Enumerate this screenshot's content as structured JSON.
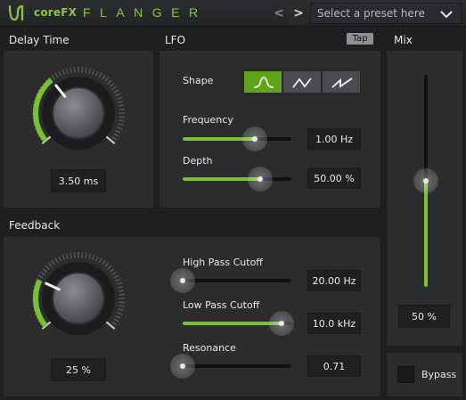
{
  "header": {
    "app_name": "coreFX",
    "plugin_name": "FLANGER",
    "prev_label": "<",
    "next_label": ">",
    "preset_placeholder": "Select a preset here"
  },
  "delay": {
    "label": "Delay Time",
    "value": "3.50 ms",
    "knob_fraction": 0.35
  },
  "lfo": {
    "label": "LFO",
    "tap_label": "Tap",
    "shape_label": "Shape",
    "shapes": [
      "sine",
      "triangle",
      "sawtooth"
    ],
    "selected_shape": "sine",
    "frequency_label": "Frequency",
    "frequency_value": "1.00 Hz",
    "frequency_fraction": 0.66,
    "depth_label": "Depth",
    "depth_value": "50.00 %",
    "depth_fraction": 0.71
  },
  "mix": {
    "label": "Mix",
    "value": "50 %",
    "fraction": 0.5
  },
  "feedback": {
    "label": "Feedback",
    "value": "25 %",
    "knob_fraction": 0.25,
    "hp_label": "High Pass Cutoff",
    "hp_value": "20.00 Hz",
    "hp_fraction": 0.0,
    "lp_label": "Low Pass Cutoff",
    "lp_value": "10.0 kHz",
    "lp_fraction": 0.91,
    "res_label": "Resonance",
    "res_value": "0.71",
    "res_fraction": 0.0
  },
  "bypass": {
    "label": "Bypass",
    "checked": false
  },
  "colors": {
    "accent": "#7bc030",
    "background": "#1e1f21",
    "panel": "#2b2c2e"
  }
}
